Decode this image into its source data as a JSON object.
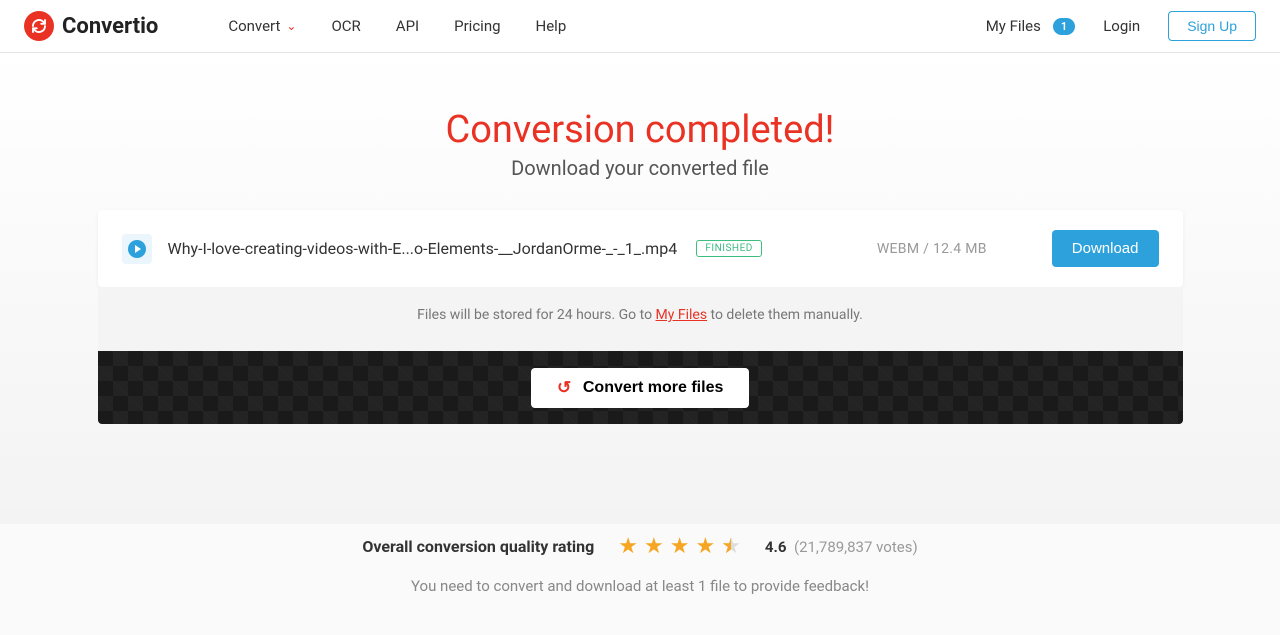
{
  "brand": "Convertio",
  "nav": {
    "convert": "Convert",
    "ocr": "OCR",
    "api": "API",
    "pricing": "Pricing",
    "help": "Help",
    "myfiles": "My Files",
    "myfiles_count": "1",
    "login": "Login",
    "signup": "Sign Up"
  },
  "hero": {
    "title": "Conversion completed!",
    "subtitle": "Download your converted file"
  },
  "file": {
    "name": "Why-I-love-creating-videos-with-E...o-Elements-__JordanOrme-_-_1_.mp4",
    "status": "FINISHED",
    "meta": "WEBM / 12.4 MB",
    "download": "Download"
  },
  "note": {
    "before": "Files will be stored for 24 hours. Go to ",
    "link": "My Files",
    "after": " to delete them manually."
  },
  "cta": "Convert more files",
  "rating": {
    "label": "Overall conversion quality rating",
    "value": "4.6",
    "count": "(21,789,837 votes)",
    "feedback": "You need to convert and download at least 1 file to provide feedback!"
  }
}
